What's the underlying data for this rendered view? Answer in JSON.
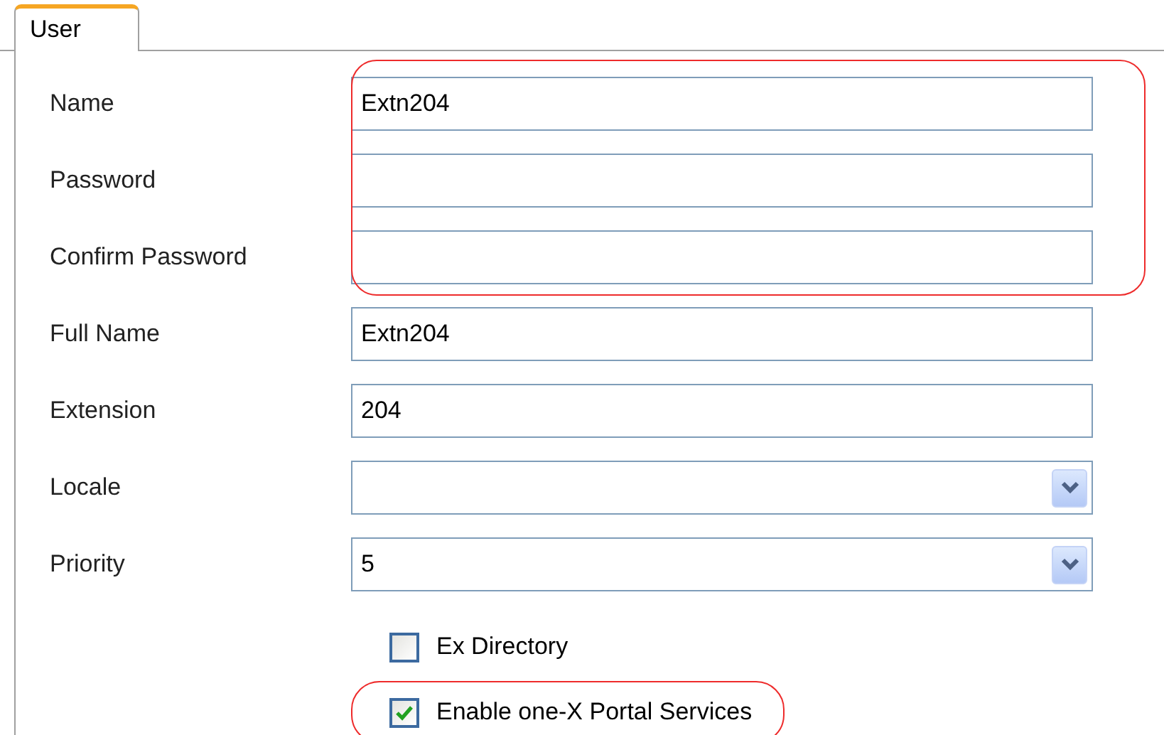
{
  "tabs": [
    {
      "label": "User",
      "selected": true
    }
  ],
  "field_groups": [
    {
      "highlighted": true,
      "fields": [
        {
          "label": "Name",
          "kind": "text",
          "value": "Extn204"
        },
        {
          "label": "Password",
          "kind": "text"
        },
        {
          "label": "Confirm Password",
          "kind": "text"
        }
      ]
    },
    {
      "highlighted": false,
      "fields": [
        {
          "label": "Full Name",
          "kind": "text",
          "value": "Extn204"
        },
        {
          "label": "Extension",
          "kind": "text",
          "value": "204"
        },
        {
          "label": "Locale",
          "kind": "select"
        },
        {
          "label": "Priority",
          "kind": "select",
          "value": "5"
        }
      ]
    }
  ],
  "checkboxes": [
    {
      "label": "Ex Directory",
      "checked": false,
      "highlighted": false
    },
    {
      "label": "Enable one-X Portal Services",
      "checked": true,
      "highlighted": true
    }
  ]
}
